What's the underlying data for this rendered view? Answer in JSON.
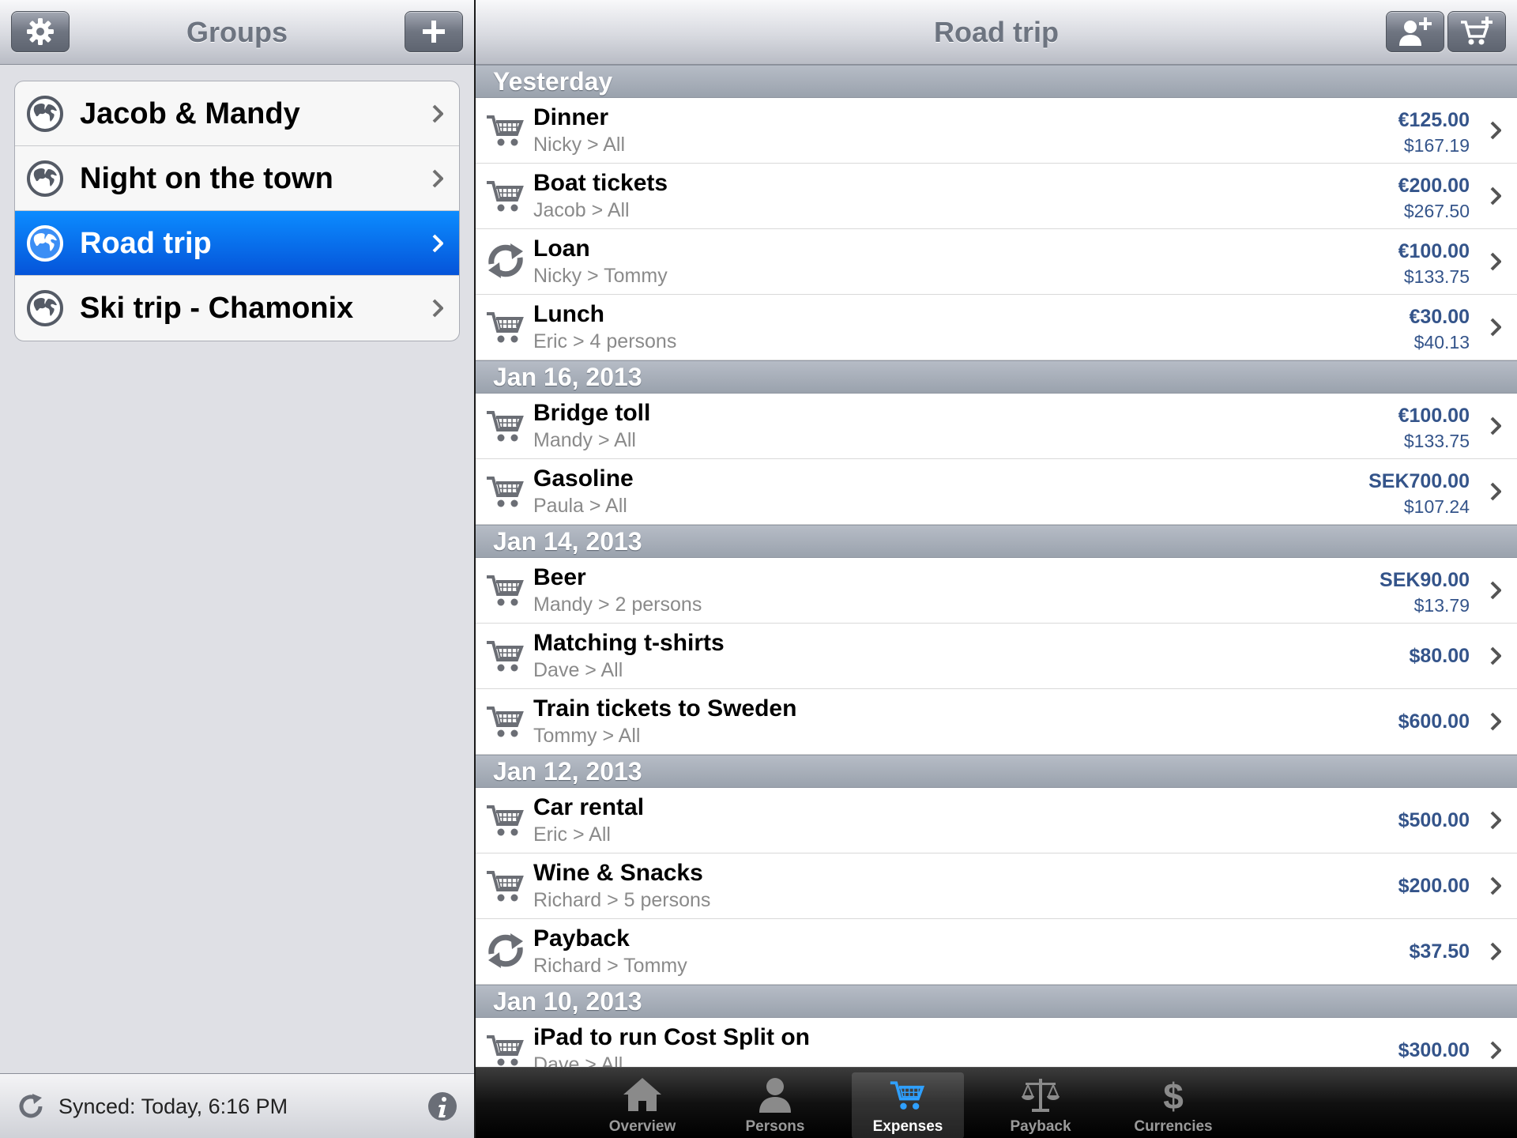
{
  "left": {
    "title": "Groups",
    "groups": [
      {
        "name": "Jacob & Mandy",
        "selected": false
      },
      {
        "name": "Night on the town",
        "selected": false
      },
      {
        "name": "Road trip",
        "selected": true
      },
      {
        "name": "Ski trip - Chamonix",
        "selected": false
      }
    ],
    "footer": {
      "sync_text": "Synced: Today, 6:16 PM"
    }
  },
  "right": {
    "title": "Road trip",
    "sections": [
      {
        "header": "Yesterday",
        "items": [
          {
            "icon": "cart-icon",
            "name": "Dinner",
            "sub": "Nicky > All",
            "amount": "€125.00",
            "converted": "$167.19"
          },
          {
            "icon": "cart-icon",
            "name": "Boat tickets",
            "sub": "Jacob > All",
            "amount": "€200.00",
            "converted": "$267.50"
          },
          {
            "icon": "transfer-icon",
            "name": "Loan",
            "sub": "Nicky > Tommy",
            "amount": "€100.00",
            "converted": "$133.75"
          },
          {
            "icon": "cart-icon",
            "name": "Lunch",
            "sub": "Eric > 4 persons",
            "amount": "€30.00",
            "converted": "$40.13"
          }
        ]
      },
      {
        "header": "Jan 16, 2013",
        "items": [
          {
            "icon": "cart-icon",
            "name": "Bridge toll",
            "sub": "Mandy > All",
            "amount": "€100.00",
            "converted": "$133.75"
          },
          {
            "icon": "cart-icon",
            "name": "Gasoline",
            "sub": "Paula > All",
            "amount": "SEK700.00",
            "converted": "$107.24"
          }
        ]
      },
      {
        "header": "Jan 14, 2013",
        "items": [
          {
            "icon": "cart-icon",
            "name": "Beer",
            "sub": "Mandy > 2 persons",
            "amount": "SEK90.00",
            "converted": "$13.79"
          },
          {
            "icon": "cart-icon",
            "name": "Matching t-shirts",
            "sub": "Dave > All",
            "amount": "$80.00",
            "converted": ""
          },
          {
            "icon": "cart-icon",
            "name": "Train tickets to Sweden",
            "sub": "Tommy > All",
            "amount": "$600.00",
            "converted": ""
          }
        ]
      },
      {
        "header": "Jan 12, 2013",
        "items": [
          {
            "icon": "cart-icon",
            "name": "Car rental",
            "sub": "Eric > All",
            "amount": "$500.00",
            "converted": ""
          },
          {
            "icon": "cart-icon",
            "name": "Wine & Snacks",
            "sub": "Richard > 5 persons",
            "amount": "$200.00",
            "converted": ""
          },
          {
            "icon": "transfer-icon",
            "name": "Payback",
            "sub": "Richard > Tommy",
            "amount": "$37.50",
            "converted": ""
          }
        ]
      },
      {
        "header": "Jan 10, 2013",
        "items": [
          {
            "icon": "cart-icon",
            "name": "iPad to run Cost Split on",
            "sub": "Dave > All",
            "amount": "$300.00",
            "converted": ""
          }
        ]
      }
    ],
    "tabs": [
      {
        "label": "Overview",
        "icon": "house-icon",
        "active": false
      },
      {
        "label": "Persons",
        "icon": "person-icon",
        "active": false
      },
      {
        "label": "Expenses",
        "icon": "cart-icon",
        "active": true
      },
      {
        "label": "Payback",
        "icon": "scales-icon",
        "active": false
      },
      {
        "label": "Currencies",
        "icon": "dollar-icon",
        "active": false
      }
    ]
  },
  "colors": {
    "selected_row": "#0a6ff0",
    "amount": "#34548a",
    "tab_active": "#2fa0ff"
  }
}
